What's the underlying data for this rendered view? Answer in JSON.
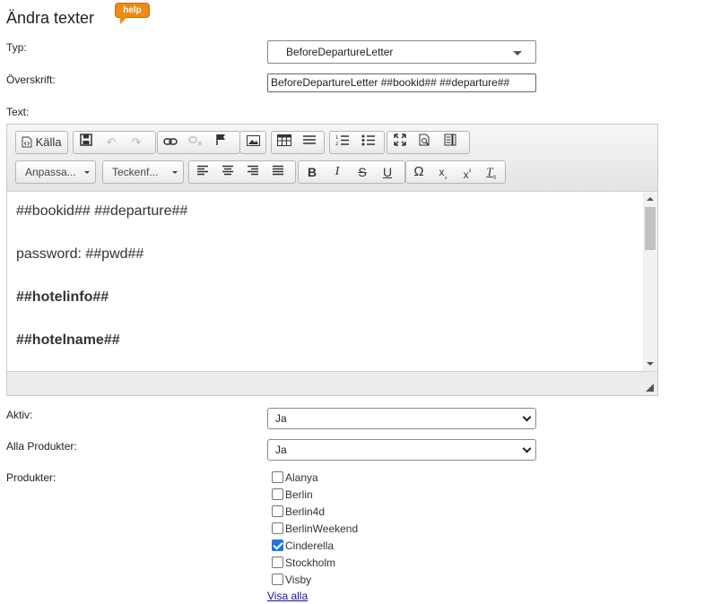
{
  "page": {
    "title": "Ändra texter",
    "help_label": "help"
  },
  "form": {
    "typ_label": "Typ:",
    "typ_value": "BeforeDepartureLetter",
    "overskrift_label": "Överskrift:",
    "overskrift_value": "BeforeDepartureLetter ##bookid## ##departure##",
    "text_label": "Text:",
    "aktiv_label": "Aktiv:",
    "aktiv_value": "Ja",
    "alla_label": "Alla Produkter:",
    "alla_value": "Ja",
    "produkter_label": "Produkter:",
    "show_all_link": "Visa alla"
  },
  "editor": {
    "source_label": "Källa",
    "format_combo": "Anpassa...",
    "font_combo": "Teckenf...",
    "icons": {
      "source": "source-icon",
      "save": "save-icon",
      "undo": "undo-icon",
      "redo": "redo-icon",
      "link": "link-icon",
      "unlink": "unlink-icon",
      "anchor": "flag-icon",
      "image": "image-icon",
      "table": "table-icon",
      "hr": "horizontal-rule-icon",
      "ol": "numbered-list-icon",
      "ul": "bulleted-list-icon",
      "maximize": "maximize-icon",
      "preview": "preview-icon",
      "templates": "templates-icon",
      "align_left": "align-left-icon",
      "align_center": "align-center-icon",
      "align_right": "align-right-icon",
      "justify": "justify-icon",
      "bold": "bold-icon",
      "italic": "italic-icon",
      "strike": "strikethrough-icon",
      "underline": "underline-icon",
      "special_char": "omega-icon",
      "subscript": "subscript-icon",
      "superscript": "superscript-icon",
      "remove_format": "remove-format-icon"
    },
    "lines": [
      {
        "text": "##bookid## ##departure##",
        "bold": false
      },
      {
        "text": "password: ##pwd##",
        "bold": false
      },
      {
        "text": "##hotelinfo##",
        "bold": true
      },
      {
        "text": "##hotelname##",
        "bold": true
      }
    ]
  },
  "products": [
    {
      "name": "Alanya",
      "checked": false
    },
    {
      "name": "Berlin",
      "checked": false
    },
    {
      "name": "Berlin4d",
      "checked": false
    },
    {
      "name": "BerlinWeekend",
      "checked": false
    },
    {
      "name": "Cinderella",
      "checked": true
    },
    {
      "name": "Stockholm",
      "checked": false
    },
    {
      "name": "Visby",
      "checked": false
    }
  ],
  "colors": {
    "help_badge": "#f08a16",
    "checkbox_checked": "#1a73e8",
    "link": "#1a0dab"
  }
}
